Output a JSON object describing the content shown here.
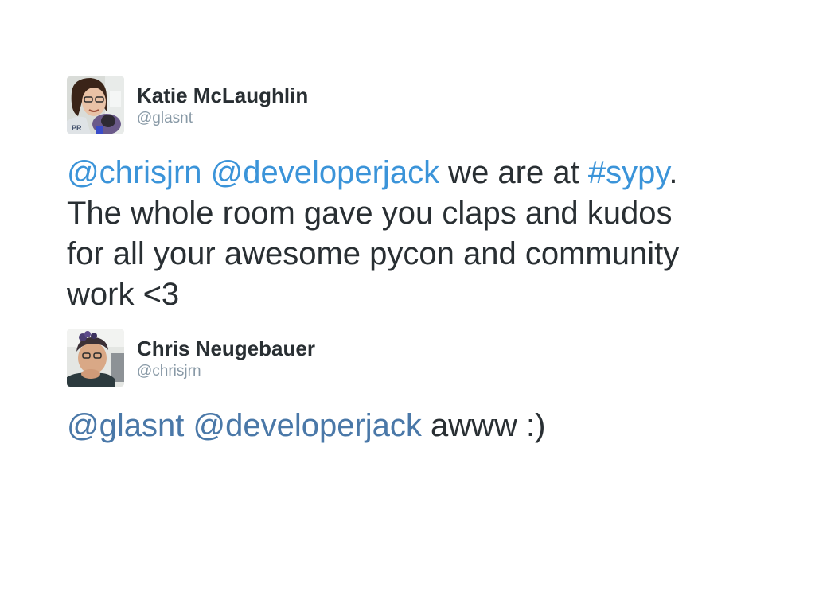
{
  "tweets": [
    {
      "author": {
        "name": "Katie McLaughlin",
        "handle": "@glasnt"
      },
      "text": {
        "mention1": "@chrisjrn",
        "sep1": " ",
        "mention2": "@developerjack",
        "mid": " we are at ",
        "hashtag": "#sypy",
        "end": ".",
        "line2": "The whole room gave you claps and kudos",
        "line3": "for all your awesome pycon and community",
        "line4": "work <3"
      }
    },
    {
      "author": {
        "name": "Chris Neugebauer",
        "handle": "@chrisjrn"
      },
      "text": {
        "mention1": "@glasnt",
        "sep1": " ",
        "mention2": "@developerjack",
        "rest": " awww :)"
      }
    }
  ],
  "colors": {
    "link_tweet1": "#3b94d9",
    "link_tweet2": "#4a78a8",
    "text": "#292f33",
    "handle": "#8899a6"
  }
}
